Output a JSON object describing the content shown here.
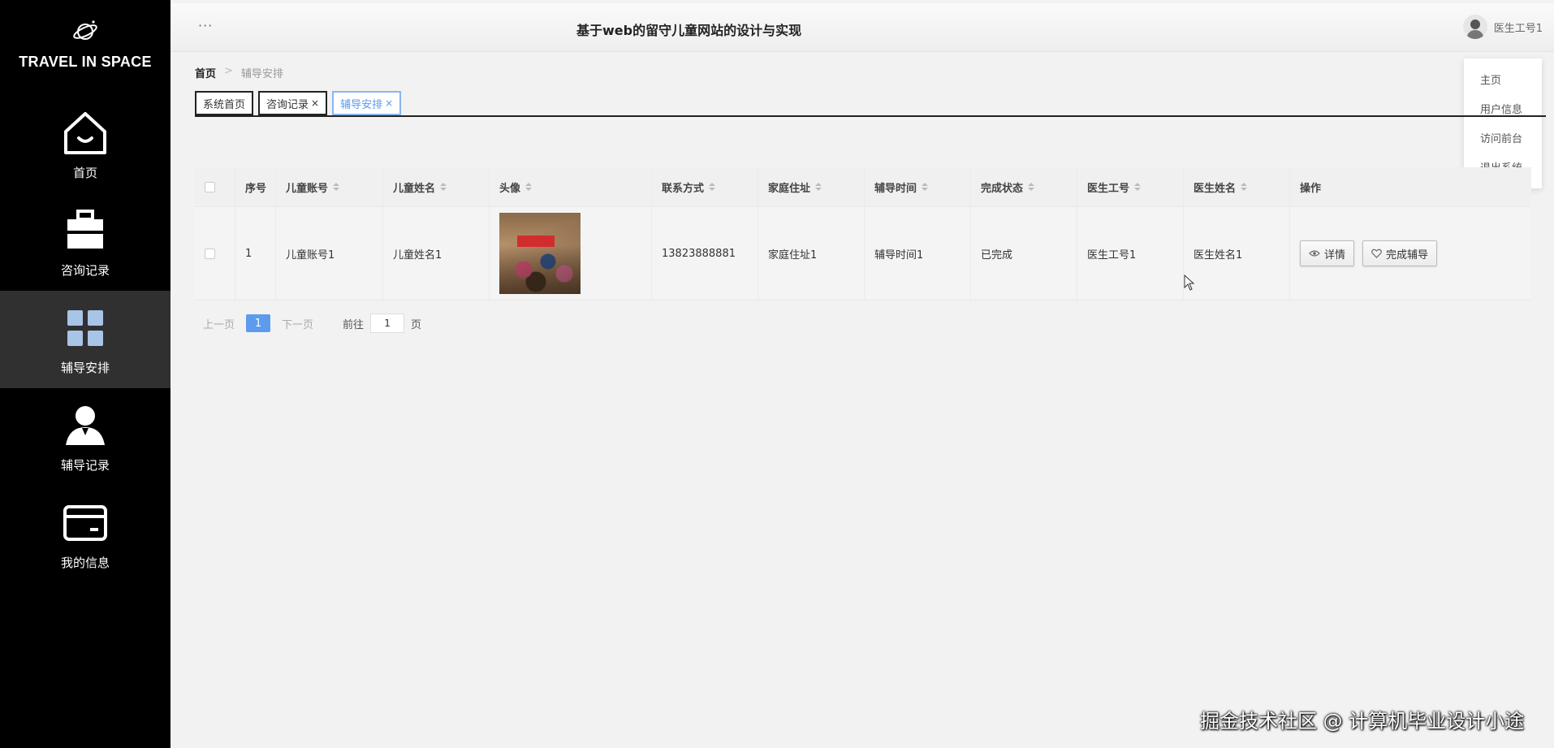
{
  "brand": {
    "name": "TRAVEL IN SPACE"
  },
  "sidebar": {
    "items": [
      {
        "label": "首页",
        "icon": "home-icon"
      },
      {
        "label": "咨询记录",
        "icon": "briefcase-icon"
      },
      {
        "label": "辅导安排",
        "icon": "grid-icon",
        "active": true
      },
      {
        "label": "辅导记录",
        "icon": "user-icon"
      },
      {
        "label": "我的信息",
        "icon": "card-icon"
      }
    ]
  },
  "header": {
    "title": "基于web的留守儿童网站的设计与实现",
    "menu_dots": "···",
    "user_name": "医生工号1"
  },
  "dropdown": {
    "items": [
      "主页",
      "用户信息",
      "访问前台",
      "退出系统"
    ]
  },
  "breadcrumb": {
    "home": "首页",
    "separator": ">",
    "current": "辅导安排"
  },
  "tabs": [
    {
      "label": "系统首页",
      "closable": false
    },
    {
      "label": "咨询记录",
      "closable": true
    },
    {
      "label": "辅导安排",
      "closable": true,
      "active": true
    }
  ],
  "tab_close": "×",
  "table": {
    "columns": [
      "序号",
      "儿童账号",
      "儿童姓名",
      "头像",
      "联系方式",
      "家庭住址",
      "辅导时间",
      "完成状态",
      "医生工号",
      "医生姓名",
      "操作"
    ],
    "rows": [
      {
        "index": "1",
        "child_account": "儿童账号1",
        "child_name": "儿童姓名1",
        "phone": "13823888881",
        "address": "家庭住址1",
        "tutor_time": "辅导时间1",
        "status": "已完成",
        "doctor_id": "医生工号1",
        "doctor_name": "医生姓名1"
      }
    ],
    "actions": {
      "detail": "详情",
      "complete": "完成辅导"
    }
  },
  "pagination": {
    "prev": "上一页",
    "current_page": "1",
    "next": "下一页",
    "goto_prefix": "前往",
    "goto_value": "1",
    "goto_suffix": "页"
  },
  "watermark": "掘金技术社区 @ 计算机毕业设计小途",
  "colors": {
    "sidebar_bg": "#000000",
    "accent": "#5d9cec",
    "active_nav": "#303030"
  }
}
